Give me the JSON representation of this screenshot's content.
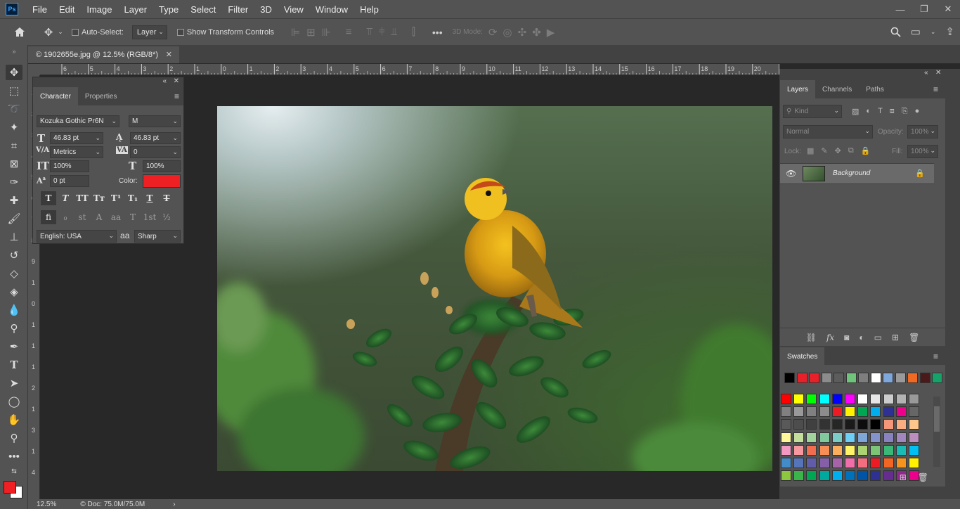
{
  "app": {
    "logo": "Ps"
  },
  "menu": [
    "File",
    "Edit",
    "Image",
    "Layer",
    "Type",
    "Select",
    "Filter",
    "3D",
    "View",
    "Window",
    "Help"
  ],
  "options": {
    "auto_select_label": "Auto-Select:",
    "auto_select_value": "Layer",
    "transform_label": "Show Transform Controls",
    "mode_3d": "3D Mode:"
  },
  "document": {
    "tab_title": "© 1902655e.jpg @ 12.5% (RGB/8*)",
    "zoom": "12.5%",
    "doc_size": "© Doc: 75.0M/75.0M"
  },
  "ruler_labels": [
    "6",
    "5",
    "4",
    "3",
    "2",
    "1",
    "0",
    "1",
    "2",
    "3",
    "4",
    "5",
    "6",
    "7",
    "8",
    "9",
    "10",
    "11",
    "12",
    "13",
    "14",
    "15",
    "16",
    "17",
    "18",
    "19",
    "20",
    "21"
  ],
  "ruler_left_labels": [
    "1",
    "2",
    "3",
    "4",
    "5",
    "6",
    "7",
    "8",
    "9",
    "1",
    "0",
    "1",
    "1",
    "1",
    "2",
    "1",
    "3",
    "1",
    "4"
  ],
  "character": {
    "tab_character": "Character",
    "tab_properties": "Properties",
    "font_family": "Kozuka Gothic Pr6N",
    "font_style": "M",
    "font_size": "46.83 pt",
    "leading": "46.83 pt",
    "kerning": "Metrics",
    "tracking": "0",
    "vertical_scale": "100%",
    "horizontal_scale": "100%",
    "baseline_shift": "0 pt",
    "color_label": "Color:",
    "color_value": "#ee2024",
    "language": "English: USA",
    "aa_label": "a",
    "antialias": "Sharp",
    "type_buttons": [
      "T",
      "T",
      "TT",
      "Tт",
      "T¹",
      "T₁",
      "T",
      "T"
    ],
    "opentype_buttons": [
      "ﬁ",
      "ℴ",
      "st",
      "A",
      "aa",
      "T",
      "1st",
      "½"
    ]
  },
  "layers": {
    "tabs": [
      "Layers",
      "Channels",
      "Paths"
    ],
    "filter_placeholder": "Kind",
    "blend_mode": "Normal",
    "opacity_label": "Opacity:",
    "opacity_value": "100%",
    "lock_label": "Lock:",
    "fill_label": "Fill:",
    "fill_value": "100%",
    "layer_name": "Background"
  },
  "swatches": {
    "title": "Swatches",
    "recent": [
      "#000000",
      "#e8202a",
      "#e8202a",
      "#8c8c8c",
      "#5c5c5c",
      "#6fc37a",
      "#7e7e7e",
      "#ffffff",
      "#7ea7dc",
      "#9a9a9a",
      "#f06a24",
      "#4a1a1a",
      "#15a36a"
    ],
    "grid": [
      [
        "#ff0000",
        "#ffff00",
        "#00ff00",
        "#00ffff",
        "#0000ff",
        "#ff00ff",
        "#ffffff",
        "#e6e6e6",
        "#cccccc",
        "#b3b3b3",
        "#999999"
      ],
      [
        "#808080",
        "#999999",
        "#808080",
        "#8c8c8c",
        "#ed1c24",
        "#fff200",
        "#00a651",
        "#00aeef",
        "#2e3192",
        "#ec008c",
        "#666666"
      ],
      [
        "#595959",
        "#4d4d4d",
        "#404040",
        "#333333",
        "#262626",
        "#1a1a1a",
        "#0d0d0d",
        "#000000",
        "#f7977a",
        "#f9ad81",
        "#fdc68a"
      ],
      [
        "#fff79a",
        "#c4df9b",
        "#a3d39c",
        "#82ca9d",
        "#7bcdc8",
        "#6ecff6",
        "#7ea7d8",
        "#8493ca",
        "#8882be",
        "#a187be",
        "#bc8dbf"
      ],
      [
        "#f49ac2",
        "#f6989d",
        "#f26c4f",
        "#f68e55",
        "#fbaf5c",
        "#fff467",
        "#acd372",
        "#7cc576",
        "#3bb878",
        "#1abbb4",
        "#00bff3"
      ],
      [
        "#438cca",
        "#5574b9",
        "#605ca8",
        "#855fa8",
        "#a763a8",
        "#f06eaa",
        "#f26d7d",
        "#ed1c24",
        "#f26522",
        "#f7941d",
        "#fff200"
      ],
      [
        "#8dc63f",
        "#39b54a",
        "#00a651",
        "#00a99d",
        "#00aeef",
        "#0072bc",
        "#0054a6",
        "#2e3192",
        "#662d91",
        "#92278f",
        "#ec008c"
      ]
    ]
  },
  "colors": {
    "foreground": "#ee2024",
    "background": "#ffffff"
  }
}
